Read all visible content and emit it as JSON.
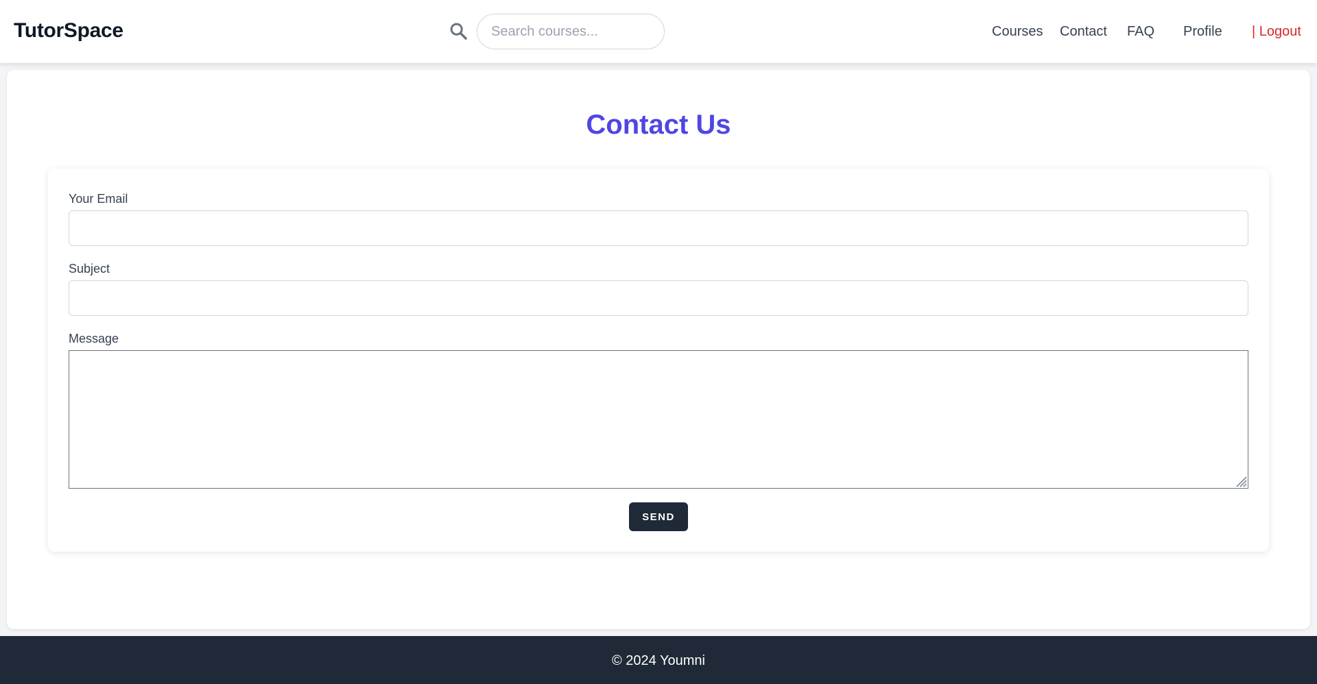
{
  "navbar": {
    "brand": "TutorSpace",
    "search": {
      "placeholder": "Search courses...",
      "value": ""
    },
    "links": [
      {
        "label": "Courses"
      },
      {
        "label": "Contact"
      },
      {
        "label": "FAQ"
      },
      {
        "label": "Profile"
      },
      {
        "label": "| Logout"
      }
    ]
  },
  "page": {
    "title": "Contact Us"
  },
  "form": {
    "email": {
      "label": "Your Email",
      "value": ""
    },
    "subject": {
      "label": "Subject",
      "value": ""
    },
    "message": {
      "label": "Message",
      "value": ""
    },
    "send_label": "SEND"
  },
  "footer": {
    "text": "© 2024 Youmni"
  },
  "colors": {
    "accent": "#4f46e5",
    "dark": "#1f2937",
    "logout": "#dc2626"
  },
  "icons": {
    "search": "search-icon",
    "resize": "resize-handle-icon"
  }
}
